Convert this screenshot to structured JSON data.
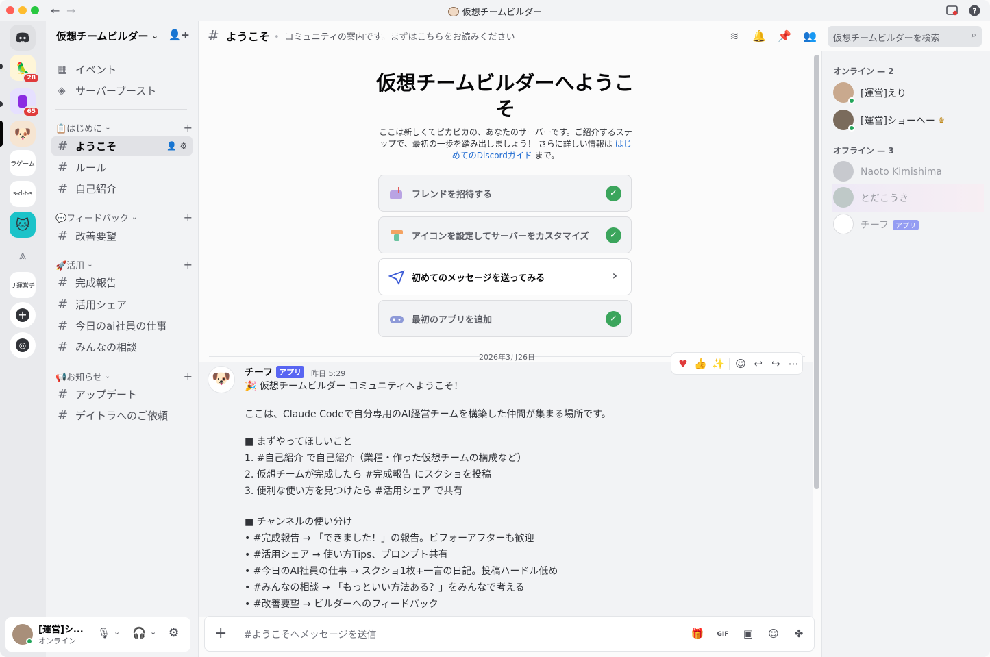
{
  "window": {
    "title": "仮想チームビルダー"
  },
  "rail": {
    "servers": [
      {
        "name": "discord-home",
        "badge": ""
      },
      {
        "name": "server-1",
        "badge": "28"
      },
      {
        "name": "server-2",
        "badge": "65"
      },
      {
        "name": "vteam",
        "badge": ""
      },
      {
        "name": "ラゲーム",
        "badge": ""
      },
      {
        "name": "s-d-t-s",
        "badge": ""
      },
      {
        "name": "server-cat",
        "badge": ""
      },
      {
        "name": "server-a",
        "badge": ""
      },
      {
        "name": "リ運営チ",
        "badge": ""
      }
    ]
  },
  "sidebar": {
    "server_name": "仮想チームビルダー",
    "top_items": [
      {
        "label": "イベント"
      },
      {
        "label": "サーバーブースト"
      }
    ],
    "categories": [
      {
        "label": "📋はじめに",
        "channels": [
          "ようこそ",
          "ルール",
          "自己紹介"
        ]
      },
      {
        "label": "💬フィードバック",
        "channels": [
          "改善要望"
        ]
      },
      {
        "label": "🚀活用",
        "channels": [
          "完成報告",
          "活用シェア",
          "今日のai社員の仕事",
          "みんなの相談"
        ]
      },
      {
        "label": "📢お知らせ",
        "channels": [
          "アップデート",
          "デイトラへのご依頼"
        ]
      }
    ]
  },
  "user": {
    "name": "[運営]シ...",
    "status": "オンライン"
  },
  "header": {
    "channel": "ようこそ",
    "topic": "コミュニティの案内です。まずはこちらをお読みください",
    "search_placeholder": "仮想チームビルダーを検索"
  },
  "welcome": {
    "title": "仮想チームビルダーへようこそ",
    "desc_1": "ここは新しくてピカピカの、あなたのサーバーです。ご紹介するステップで、最初の一歩を踏み出しましょう！ さらに詳しい情報は",
    "desc_link": "はじめてのDiscordガイド",
    "desc_2": "まで。",
    "cards": [
      {
        "label": "フレンドを招待する",
        "done": true
      },
      {
        "label": "アイコンを設定してサーバーをカスタマイズ",
        "done": true
      },
      {
        "label": "初めてのメッセージを送ってみる",
        "done": false
      },
      {
        "label": "最初のアプリを追加",
        "done": true
      }
    ]
  },
  "date_separator": "2026年3月26日",
  "message": {
    "author": "チーフ",
    "tag": "アプリ",
    "time": "昨日 5:29",
    "lines": [
      "🎉 仮想チームビルダー コミュニティへようこそ！",
      "ここは、Claude Codeで自分専用のAI経営チームを構築した仲間が集まる場所です。",
      "■ まずやってほしいこと",
      "1. #自己紹介 で自己紹介（業種・作った仮想チームの構成など）",
      "2. 仮想チームが完成したら #完成報告 にスクショを投稿",
      "3. 便利な使い方を見つけたら #活用シェア で共有",
      "■ チャンネルの使い分け",
      "•  #完成報告 → 「できました！」の報告。ビフォーアフターも歓迎",
      "•  #活用シェア → 使い方Tips、プロンプト共有",
      "•  #今日のAI社員の仕事 → スクショ1枚+一言の日記。投稿ハードル低め",
      "•  #みんなの相談 → 「もっといい方法ある？」をみんなで考える",
      "•  #改善要望 → ビルダーへのフィードバック"
    ]
  },
  "composer": {
    "placeholder": "#ようこそへメッセージを送信"
  },
  "members": {
    "online_header": "オンライン — 2",
    "online": [
      "[運営]えり",
      "[運営]ショーヘー"
    ],
    "offline_header": "オフライン — 3",
    "offline": [
      "Naoto Kimishima",
      "とだこうき",
      "チーフ"
    ],
    "bot_tag": "アプリ"
  },
  "colors": {
    "accent": "#5865f2",
    "success": "#3ba55c",
    "link": "#1f6bd1",
    "danger": "#e03b3b"
  }
}
